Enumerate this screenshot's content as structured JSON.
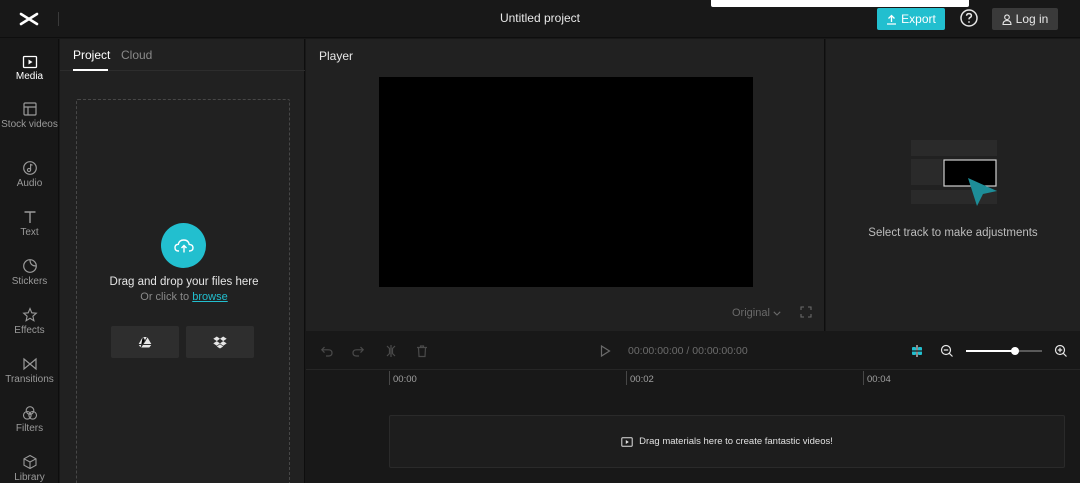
{
  "header": {
    "project_title": "Untitled project",
    "export_label": "Export",
    "login_label": "Log in"
  },
  "sidebar": {
    "items": [
      {
        "label": "Media",
        "icon": "media-icon",
        "active": true
      },
      {
        "label": "Stock videos",
        "icon": "stock-videos-icon"
      },
      {
        "label": "Audio",
        "icon": "audio-icon"
      },
      {
        "label": "Text",
        "icon": "text-icon"
      },
      {
        "label": "Stickers",
        "icon": "stickers-icon"
      },
      {
        "label": "Effects",
        "icon": "effects-icon"
      },
      {
        "label": "Transitions",
        "icon": "transitions-icon"
      },
      {
        "label": "Filters",
        "icon": "filters-icon"
      },
      {
        "label": "Library",
        "icon": "library-icon"
      }
    ]
  },
  "media_panel": {
    "tabs": [
      {
        "label": "Project",
        "active": true
      },
      {
        "label": "Cloud"
      }
    ],
    "drop_title": "Drag and drop your files here",
    "drop_sub_prefix": "Or click to",
    "browse_label": "browse",
    "cloud_sources": [
      "google-drive-icon",
      "dropbox-icon"
    ]
  },
  "player": {
    "title": "Player",
    "ratio_label": "Original"
  },
  "inspector": {
    "message": "Select track to make adjustments"
  },
  "timeline": {
    "timecode_current": "00:00:00:00",
    "timecode_separator": "/",
    "timecode_total": "00:00:00:00",
    "zoom_level": 0.65,
    "ruler_labels": [
      "00:00",
      "00:02",
      "00:04"
    ],
    "empty_message": "Drag materials here to create fantastic videos!"
  },
  "colors": {
    "accent": "#22bfcf",
    "background": "#181818",
    "panel": "#212121"
  }
}
